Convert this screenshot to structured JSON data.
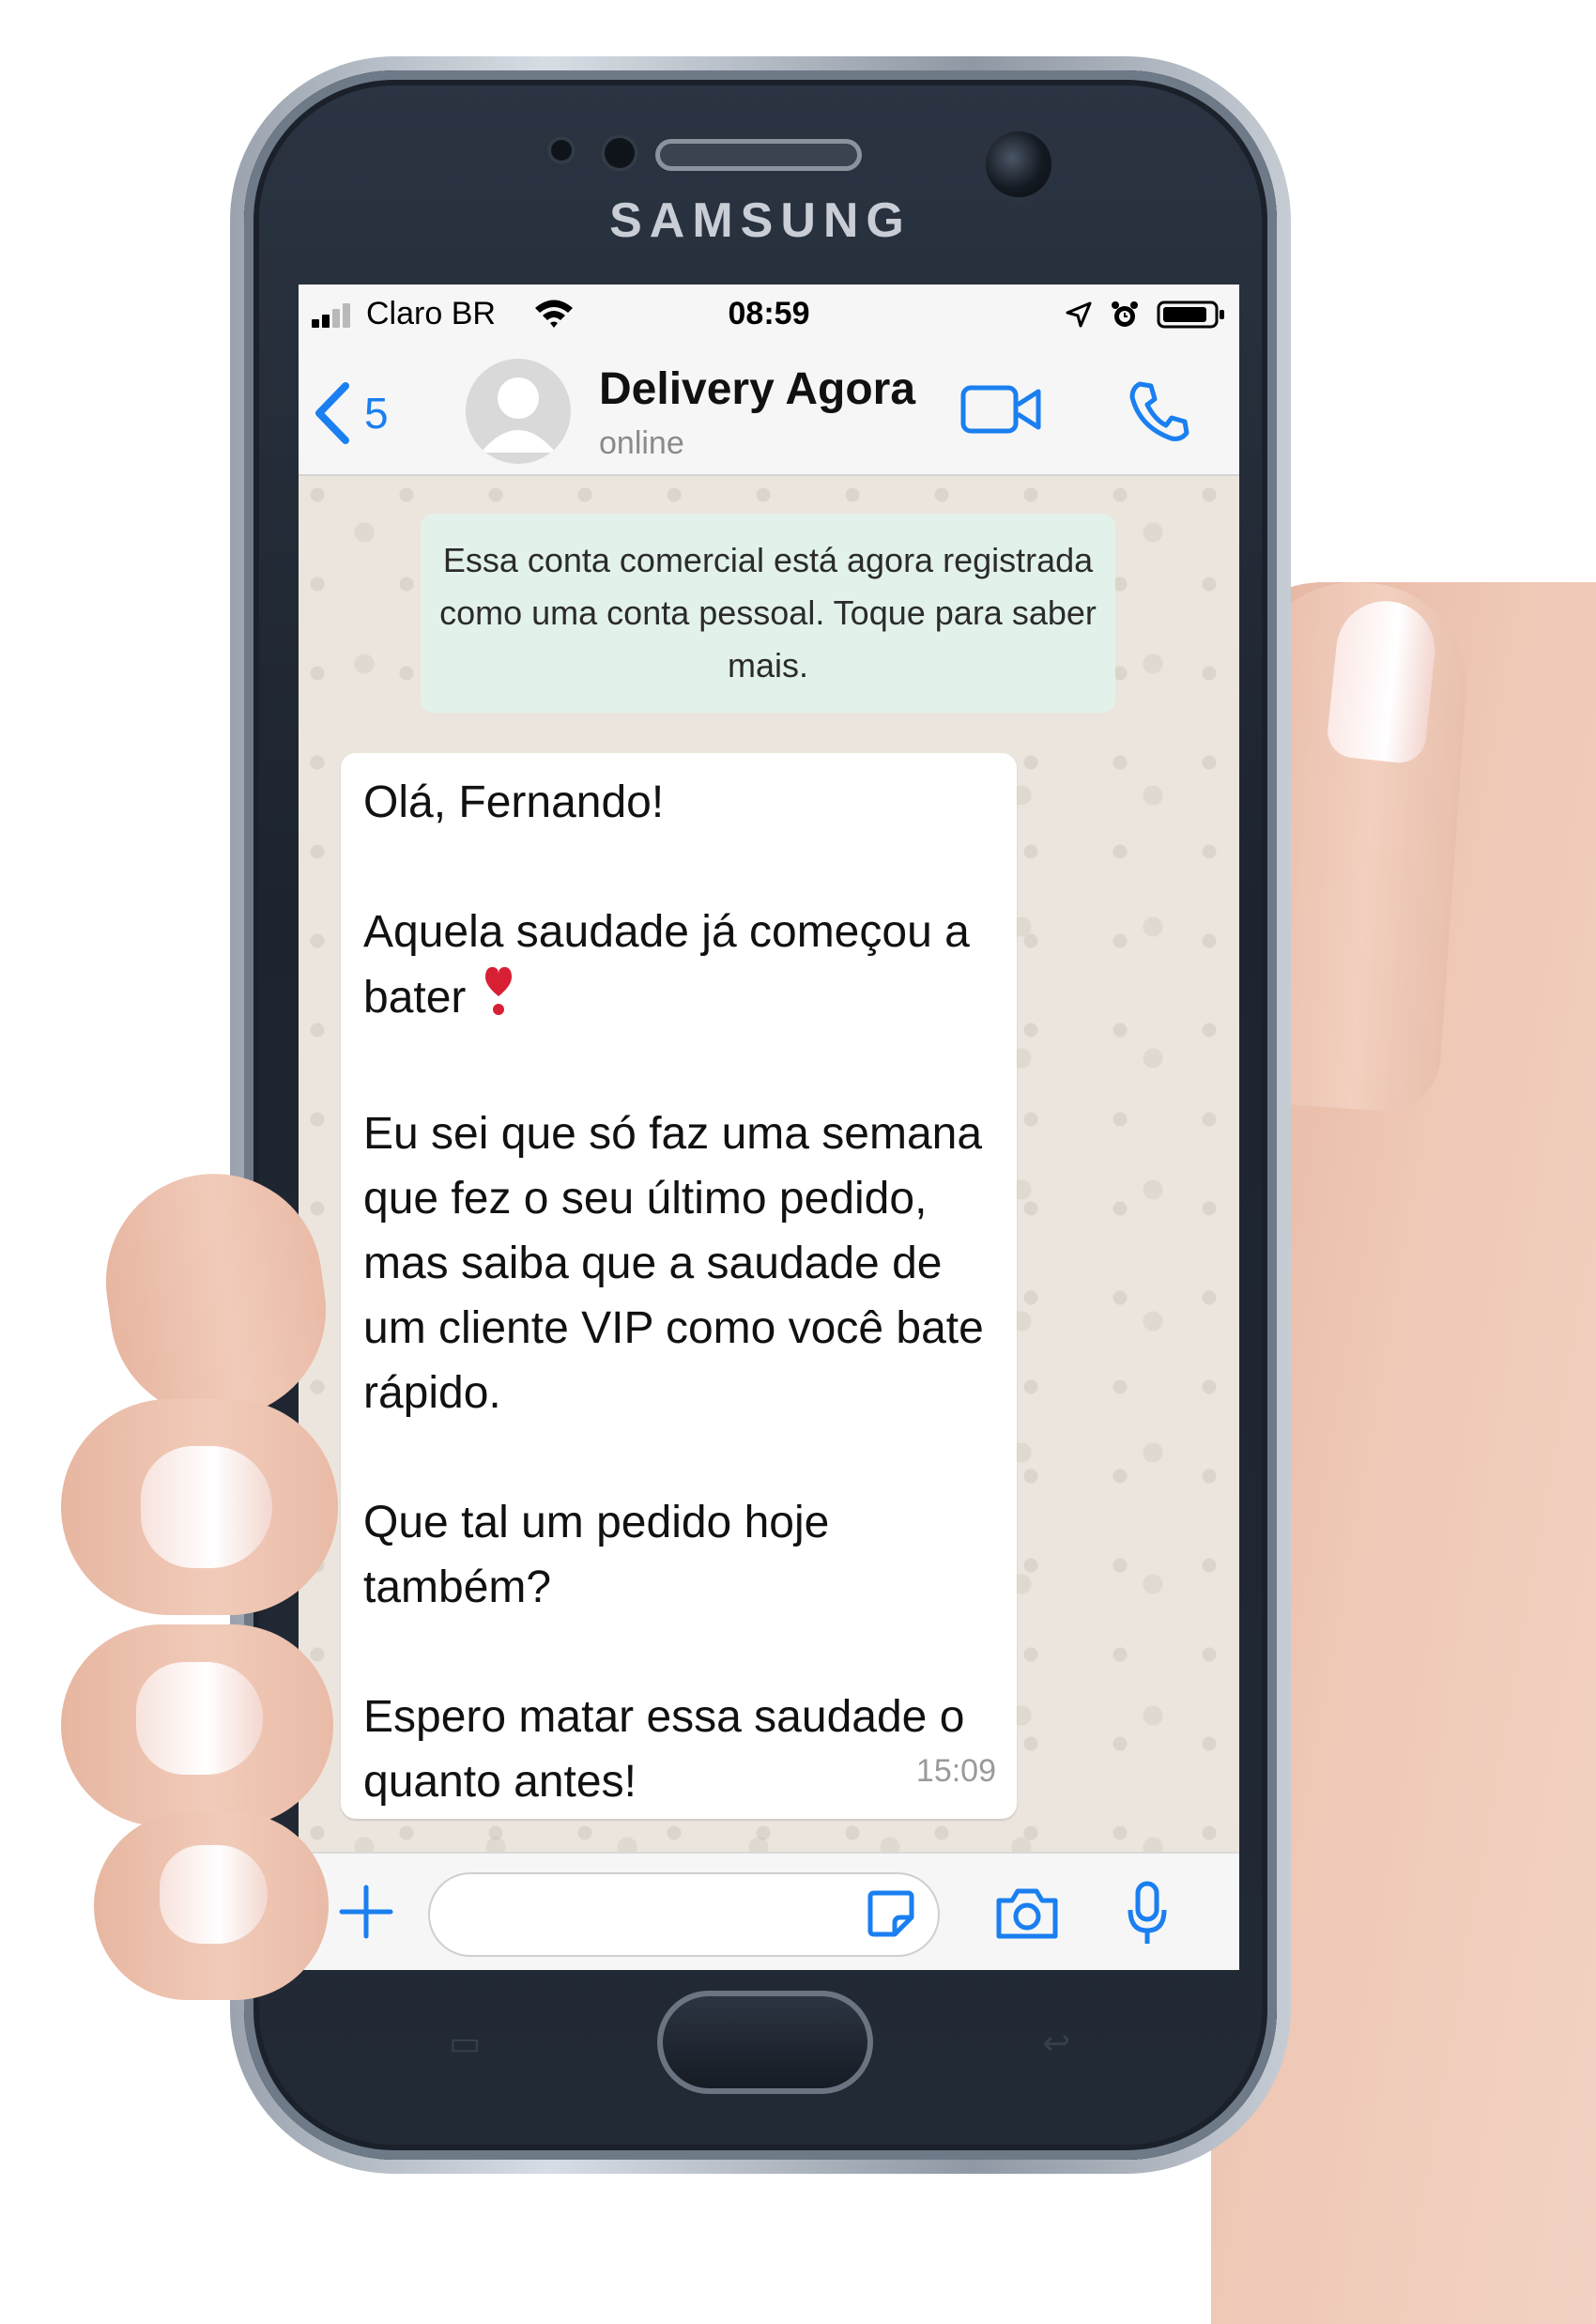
{
  "device": {
    "brand": "SAMSUNG"
  },
  "status_bar": {
    "carrier": "Claro BR",
    "time": "08:59"
  },
  "header": {
    "back_count": "5",
    "contact_name": "Delivery Agora",
    "contact_status": "online"
  },
  "chat": {
    "system_notice": "Essa conta comercial está agora registrada como uma conta pessoal. Toque para saber mais.",
    "message": {
      "greeting": "Olá, Fernando!",
      "line1": "Aquela saudade já começou a bater",
      "line2": "Eu sei que só faz uma semana que fez o seu último pedido, mas saiba que a saudade de um cliente VIP como você bate rápido.",
      "line3": "Que tal um pedido hoje também?",
      "line4": "Espero matar essa saudade o quanto antes!",
      "time": "15:09"
    }
  },
  "icons": {
    "signal": "signal-bars-icon",
    "wifi": "wifi-icon",
    "location": "location-arrow-icon",
    "alarm": "alarm-clock-icon",
    "battery": "battery-icon",
    "back": "chevron-left-icon",
    "avatar": "default-avatar-icon",
    "video": "video-camera-icon",
    "phone": "phone-icon",
    "heart": "heart-exclamation-emoji",
    "plus": "plus-icon",
    "sticker": "sticker-icon",
    "camera": "camera-icon",
    "mic": "microphone-icon"
  },
  "colors": {
    "accent": "#1a7ff0",
    "chat_background": "#ece5dd",
    "notice_background": "#e2f2ea",
    "bubble_background": "#ffffff"
  }
}
